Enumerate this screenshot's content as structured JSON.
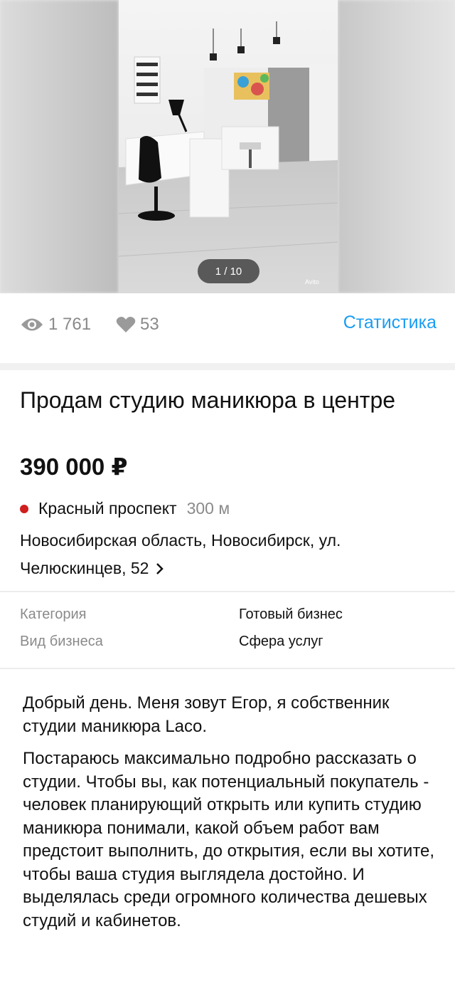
{
  "gallery": {
    "counter": "1 / 10",
    "watermark": "Avito"
  },
  "stats": {
    "views": "1 761",
    "likes": "53",
    "link_label": "Статистика",
    "accent_color": "#1a9cf3"
  },
  "listing": {
    "title": "Продам студию маникюра в центре",
    "price": "390 000 ₽",
    "metro": {
      "station": "Красный проспект",
      "distance": "300 м",
      "line_color": "#cf1f1f"
    },
    "address": "Новосибирская область, Новосибирск, ул. Челюскинцев, 52"
  },
  "params": [
    {
      "label": "Категория",
      "value": "Готовый бизнес"
    },
    {
      "label": "Вид бизнеса",
      "value": "Сфера услуг"
    }
  ],
  "description": [
    "Добрый день. Меня зовут Егор, я собственник студии маникюра Laco.",
    "Постараюсь максимально подробно рассказать о студии. Чтобы вы, как потенциальный покупатель - человек планирующий открыть или купить студию маникюра понимали, какой объем работ вам предстоит выполнить, до открытия, если вы хотите, чтобы ваша студия выглядела достойно. И выделялась среди огромного количества дешевых студий и кабинетов."
  ]
}
